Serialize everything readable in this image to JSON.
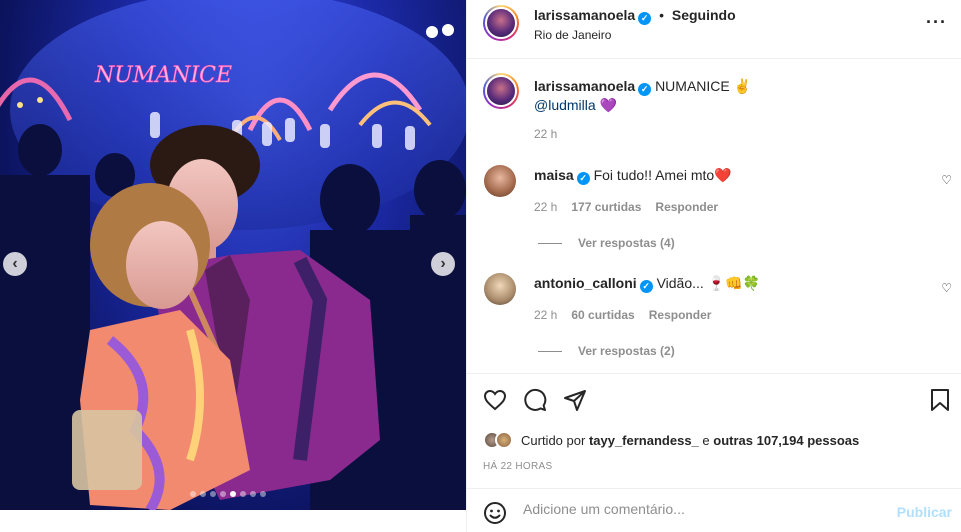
{
  "post": {
    "username": "larissamanoela",
    "follow_status": "Seguindo",
    "separator": "•",
    "location": "Rio de Janeiro",
    "more_icon": "more-horizontal-icon"
  },
  "photo": {
    "neon_sign": "NUMANICE",
    "carousel_dots": 8,
    "active_dot": 4
  },
  "caption": {
    "username": "larissamanoela",
    "text": "NUMANICE ✌",
    "mention": "@ludmilla",
    "emoji": "💜",
    "time": "22 h"
  },
  "comments": [
    {
      "username": "maisa",
      "text": "Foi tudo!! Amei mto❤️",
      "time": "22 h",
      "likes": "177 curtidas",
      "reply_label": "Responder",
      "view_replies": "Ver respostas (4)"
    },
    {
      "username": "antonio_calloni",
      "text": "Vidão... 🍷👊🍀",
      "time": "22 h",
      "likes": "60 curtidas",
      "reply_label": "Responder",
      "view_replies": "Ver respostas (2)"
    }
  ],
  "likes": {
    "prefix": "Curtido por",
    "user": "tayy_fernandess_",
    "middle": "e",
    "others": "outras 107,194 pessoas"
  },
  "posted_time": "HÁ 22 HORAS",
  "add_comment": {
    "placeholder": "Adicione um comentário...",
    "publish_label": "Publicar"
  },
  "colors": {
    "verified": "#0095f6",
    "link": "#00376b",
    "secondary_text": "#8e8e8e",
    "publish_disabled": "#b2dffc"
  }
}
